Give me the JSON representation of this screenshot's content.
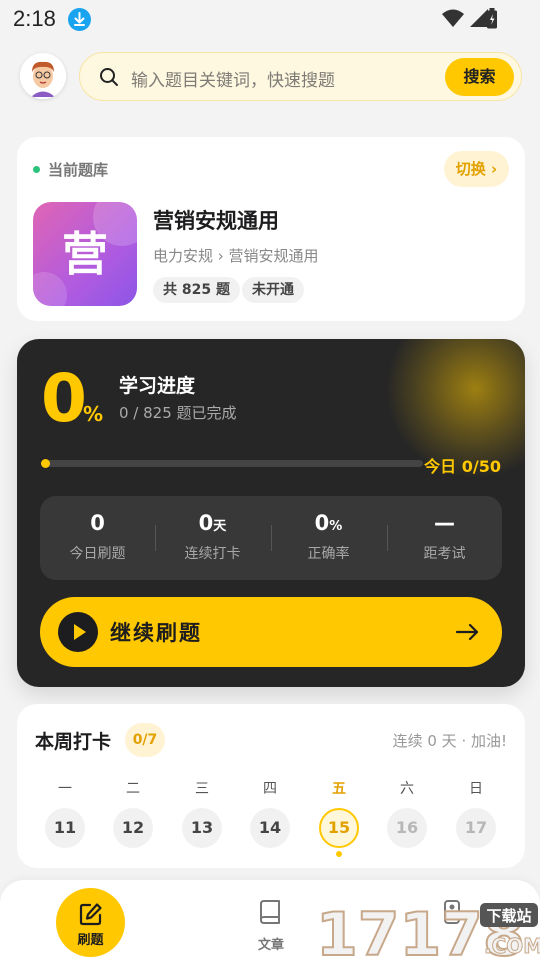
{
  "status_bar": {
    "time": "2:18"
  },
  "search": {
    "placeholder": "输入题目关键词，快速搜题",
    "button": "搜索"
  },
  "bank": {
    "label": "当前题库",
    "switch": "切换 ›",
    "thumb_char": "营",
    "name": "营销安规通用",
    "path": "电力安规 › 营销安规通用",
    "count_tag": "共 825 题",
    "status_tag": "未开通"
  },
  "progress": {
    "percent": "0",
    "percent_sign": "%",
    "title": "学习进度",
    "subtitle": "0 / 825 题已完成",
    "today": "今日 0/50",
    "fill_fraction": 0,
    "stats": [
      {
        "value": "0",
        "unit": "",
        "label": "今日刷题"
      },
      {
        "value": "0",
        "unit": "天",
        "label": "连续打卡"
      },
      {
        "value": "0",
        "unit": "%",
        "label": "正确率"
      },
      {
        "value": "—",
        "unit": "",
        "label": "距考试"
      }
    ],
    "continue": "继续刷题"
  },
  "week": {
    "title": "本周打卡",
    "badge": "0/7",
    "streak": "连续 0 天 · 加油!",
    "days": [
      {
        "name": "一",
        "date": "11"
      },
      {
        "name": "二",
        "date": "12"
      },
      {
        "name": "三",
        "date": "13"
      },
      {
        "name": "四",
        "date": "14"
      },
      {
        "name": "五",
        "date": "15"
      },
      {
        "name": "六",
        "date": "16"
      },
      {
        "name": "日",
        "date": "17"
      }
    ]
  },
  "nav": {
    "home": "刷题",
    "articles": "文章",
    "third": ""
  },
  "watermark": {
    "text": "17178",
    "badge": "下载站",
    "domain": ".COM"
  },
  "colors": {
    "accent": "#ffc800",
    "dark_card": "#262626",
    "green_dot": "#2bc27a"
  }
}
